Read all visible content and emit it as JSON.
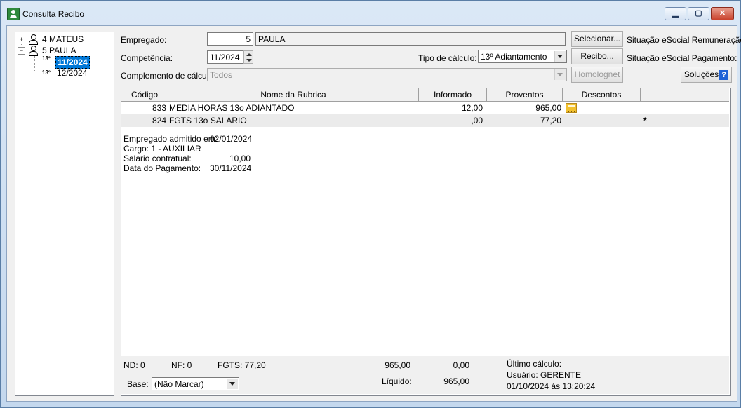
{
  "window": {
    "title": "Consulta Recibo"
  },
  "tree": {
    "items": [
      {
        "label": "4 MATEUS"
      },
      {
        "label": "5 PAULA"
      }
    ],
    "children": [
      {
        "badge": "13º",
        "label": "11/2024",
        "selected": true
      },
      {
        "badge": "13º",
        "label": "12/2024",
        "selected": false
      }
    ]
  },
  "form": {
    "empregado_label": "Empregado:",
    "empregado_code": "5",
    "empregado_name": "PAULA",
    "competencia_label": "Competência:",
    "competencia_value": "11/2024",
    "tipo_calculo_label": "Tipo de cálculo:",
    "tipo_calculo_value": "13º Adiantamento",
    "complemento_label": "Complemento de cálculo:",
    "complemento_value": "Todos"
  },
  "buttons": {
    "selecionar": "Selecionar...",
    "recibo": "Recibo...",
    "homolognet": "Homolognet",
    "solucoes": "Soluções"
  },
  "esocial": {
    "remuneracao": "Situação eSocial Remuneração:",
    "pagamento": "Situação eSocial Pagamento:"
  },
  "grid": {
    "headers": [
      "Código",
      "Nome da Rubrica",
      "Informado",
      "Proventos",
      "Descontos"
    ],
    "rows": [
      {
        "codigo": "833",
        "nome": "MEDIA HORAS 13o ADIANTADO",
        "informado": "12,00",
        "proventos": "965,00",
        "descontos": "",
        "mark": ""
      },
      {
        "codigo": "824",
        "nome": "FGTS 13o SALARIO",
        "informado": ",00",
        "proventos": "77,20",
        "descontos": "",
        "mark": "*"
      }
    ]
  },
  "details": {
    "admitido_label": "Empregado admitido em:",
    "admitido_value": "02/01/2024",
    "cargo": "Cargo: 1 - AUXILIAR",
    "salario_label": "Salario contratual:",
    "salario_value": "10,00",
    "pagamento_label": "Data do Pagamento:",
    "pagamento_value": "30/11/2024"
  },
  "footer": {
    "nd": "ND:  0",
    "nf": "NF:  0",
    "fgts": "FGTS:  77,20",
    "total_proventos": "965,00",
    "total_descontos": "0,00",
    "liquido_label": "Líquido:",
    "liquido_value": "965,00",
    "base_label": "Base:",
    "base_value": "(Não Marcar)",
    "ultimo_calculo_label": "Último cálculo:",
    "usuario": "Usuário: GERENTE",
    "data_hora": "01/10/2024 às 13:20:24"
  },
  "colors": {
    "selection": "#0078d7",
    "titlebar": "#c4d8ee",
    "close": "#c9422c",
    "help": "#1f62d6"
  },
  "icons": [
    "app-icon",
    "minimize-icon",
    "maximize-icon",
    "close-icon",
    "person-icon",
    "calculator-icon",
    "help-icon"
  ]
}
